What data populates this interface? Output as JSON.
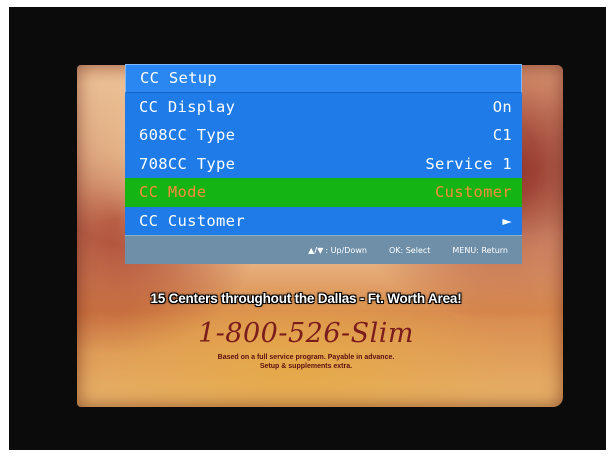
{
  "menu": {
    "title": "CC Setup",
    "items": [
      {
        "label": "CC Display",
        "value": "On"
      },
      {
        "label": "608CC Type",
        "value": "C1"
      },
      {
        "label": "708CC Type",
        "value": "Service 1"
      },
      {
        "label": "CC Mode",
        "value": "Customer",
        "selected": true
      },
      {
        "label": "CC Customer",
        "value": "►"
      }
    ],
    "hints": {
      "arrows": "▲/▼",
      "updown": ": Up/Down",
      "select": "OK: Select",
      "return": "MENU: Return"
    },
    "colors": {
      "row": "#1e7be8",
      "selected_bg": "#14b414",
      "selected_text": "#ff8a3c",
      "hint_bar": "#6f8fa8"
    }
  },
  "background_ad": {
    "tagline": "15 Centers throughout the Dallas - Ft. Worth Area!",
    "phone": "1-800-526-Slim",
    "fine_print_1": "Based on a full service program. Payable in advance.",
    "fine_print_2": "Setup & supplements extra."
  }
}
